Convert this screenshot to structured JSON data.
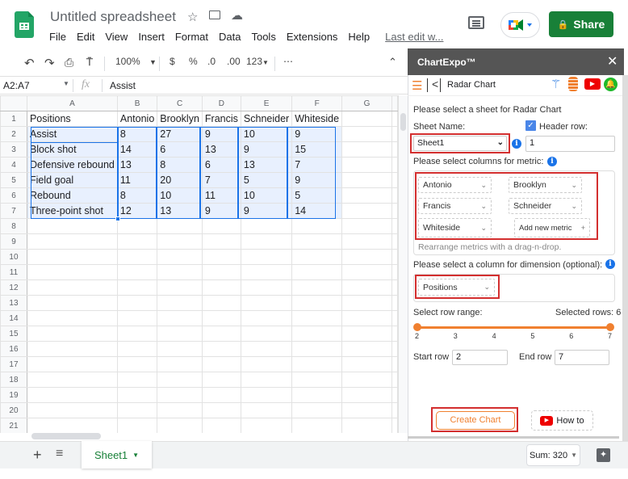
{
  "app": {
    "title": "Untitled spreadsheet",
    "menu": [
      "File",
      "Edit",
      "View",
      "Insert",
      "Format",
      "Data",
      "Tools",
      "Extensions",
      "Help"
    ],
    "last_edit": "Last edit w...",
    "share_label": "Share",
    "icons": {
      "star": "☆",
      "move": "⤷",
      "cloud": "☁"
    }
  },
  "toolbar": {
    "zoom": "100%",
    "currency": "$",
    "percent": "%",
    "dec_decrease": ".0",
    "dec_increase": ".00",
    "format": "123",
    "more": "⋯"
  },
  "formula_bar": {
    "name_box": "A2:A7",
    "fx": "fx",
    "value": "Assist"
  },
  "grid": {
    "columns": [
      "A",
      "B",
      "C",
      "D",
      "E",
      "F",
      "G"
    ],
    "rows": [
      [
        "Positions",
        "Antonio",
        "Brooklyn",
        "Francis",
        "Schneider",
        "Whiteside",
        ""
      ],
      [
        "Assist",
        "8",
        "27",
        "9",
        "10",
        "9",
        ""
      ],
      [
        "Block shot",
        "14",
        "6",
        "13",
        "9",
        "15",
        ""
      ],
      [
        "Defensive rebound",
        "13",
        "8",
        "6",
        "13",
        "7",
        ""
      ],
      [
        "Field goal",
        "11",
        "20",
        "7",
        "5",
        "9",
        ""
      ],
      [
        "Rebound",
        "8",
        "10",
        "11",
        "10",
        "5",
        ""
      ],
      [
        "Three-point shot",
        "12",
        "13",
        "9",
        "9",
        "14",
        ""
      ]
    ],
    "row_count": 21
  },
  "bottom": {
    "sheet_tab": "Sheet1",
    "sum": "Sum: 320",
    "add": "+",
    "list": "≡"
  },
  "panel": {
    "title": "ChartExpo™",
    "close": "✕",
    "chart_name": "Radar Chart",
    "select_sheet_label": "Please select a sheet for Radar Chart",
    "sheet_name_label": "Sheet Name:",
    "sheet_name_value": "Sheet1",
    "header_row_label": "Header row:",
    "header_row_checked": true,
    "header_row_value": "1",
    "metric_label": "Please select columns for metric:",
    "metrics": [
      "Antonio",
      "Brooklyn",
      "Francis",
      "Schneider",
      "Whiteside"
    ],
    "add_metric": "Add new metric",
    "rearrange_hint": "Rearrange metrics with a drag-n-drop.",
    "dimension_label": "Please select a column for dimension (optional):",
    "dimension_value": "Positions",
    "row_range_label": "Select row range:",
    "selected_rows": "Selected rows: 6",
    "range_ticks": [
      "2",
      "3",
      "4",
      "5",
      "6",
      "7"
    ],
    "range_start": 2,
    "range_end": 7,
    "start_row_label": "Start row",
    "start_row_value": "2",
    "end_row_label": "End row",
    "end_row_value": "7",
    "create_chart": "Create Chart",
    "how_to": "How to"
  }
}
